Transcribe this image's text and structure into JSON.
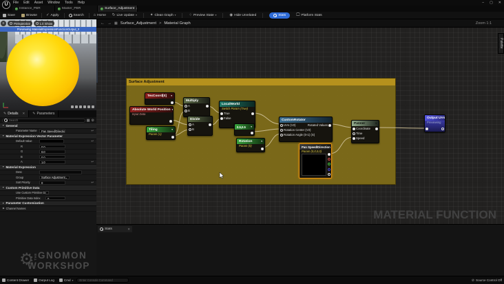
{
  "window": {
    "menus": [
      "File",
      "Edit",
      "Asset",
      "Window",
      "Tools",
      "Help"
    ],
    "logo": "U",
    "controls": {
      "minimize": "–",
      "maximize": "▢",
      "close": "✕"
    }
  },
  "tabs": [
    {
      "label": "Instance_PBR"
    },
    {
      "label": "Master_PBR"
    },
    {
      "label": "Surface_Adjustment"
    }
  ],
  "toolbar": {
    "save": "Save",
    "browse": "Browse",
    "apply": "Apply",
    "search": "Search",
    "home": "Home",
    "live_update": "Live Update",
    "clean_graph": "Clean Graph",
    "preview_state": "Preview State",
    "hide_unrelated": "Hide Unrelated",
    "stats": "Stats",
    "platform_stats": "Platform Stats"
  },
  "viewport": {
    "perspective": "Perspective",
    "lit": "Lit",
    "show": "Show",
    "previewing": "Previewing MaterialExpressionFunctionOutput_0"
  },
  "details": {
    "tab_details": "Details",
    "tab_parameters": "Parameters",
    "search_placeholder": "Search",
    "general_title": "General",
    "param_name_label": "Parameter Name",
    "param_name_value": "Pan Speed/Direction",
    "vector_param_title": "Material Expression Vector Parameter",
    "default_value_label": "Default Value",
    "channels": [
      {
        "label": "R",
        "value": "0.0"
      },
      {
        "label": "G",
        "value": "0.0"
      },
      {
        "label": "B",
        "value": "0.0"
      },
      {
        "label": "A",
        "value": "1.0"
      }
    ],
    "material_expression_title": "Material Expression",
    "desc_label": "Desc",
    "group_label": "Group",
    "group_value": "Surface Adjustment",
    "sort_label": "Sort Priority",
    "sort_value": "0",
    "custom_primitive_title": "Custom Primitive Data",
    "use_custom_label": "Use Custom Primitive Data",
    "prim_index_label": "Primitive Data Index",
    "prim_index_value": "0",
    "param_custom_title": "Parameter Customization",
    "channel_names_title": "Channel Names"
  },
  "graph": {
    "breadcrumb_left": "Surface_Adjustment",
    "breadcrumb_sep": ">",
    "breadcrumb_right": "Material Graph",
    "zoom_label": "Zoom 1:1",
    "palette_label": "Palette",
    "comment_title": "Surface Adjustment",
    "watermark": "MATERIAL FUNCTION",
    "stats_tab": "Stats",
    "nodes": {
      "texcoord": {
        "title": "TexCoord[0]"
      },
      "multiply": {
        "title": "Multiply",
        "in_a": "A",
        "in_b": "B"
      },
      "awp": {
        "title": "Absolute World Position",
        "subtitle": "Input Data"
      },
      "divide": {
        "title": "Divide",
        "in_a": "A",
        "in_b": "B"
      },
      "tiling": {
        "title": "Tiling",
        "subtitle": "Param (1)"
      },
      "localworld": {
        "title": "LocalWorld",
        "subtitle": "Switch Param (True)",
        "in_true": "True",
        "in_false": "False"
      },
      "const2": {
        "title": "0.5,0.5"
      },
      "rotation": {
        "title": "Rotation",
        "subtitle": "Param (0)"
      },
      "customrotator": {
        "title": "CustomRotator",
        "in_uvs": "UVs (V2)",
        "in_center": "Rotation Center (V2)",
        "in_angle": "Rotation Angle (0-1) (S)",
        "out": "Rotated Values"
      },
      "panspeed": {
        "title": "Pan Speed/Direction",
        "subtitle": "Param (0,0,0,0)"
      },
      "panner": {
        "title": "Panner",
        "in_coordinate": "Coordinate",
        "in_time": "Time",
        "in_speed": "Speed"
      },
      "output": {
        "title": "Output UVs",
        "subtitle": "Previewing"
      }
    }
  },
  "statusbar": {
    "content_drawer": "Content Drawer",
    "output_log": "Output Log",
    "cmd": "Cmd",
    "console_placeholder": "Enter Console Command",
    "source_control": "Source Control Off"
  },
  "brand": {
    "the": "THE",
    "line1": "GNOMON",
    "line2": "WORKSHOP"
  }
}
